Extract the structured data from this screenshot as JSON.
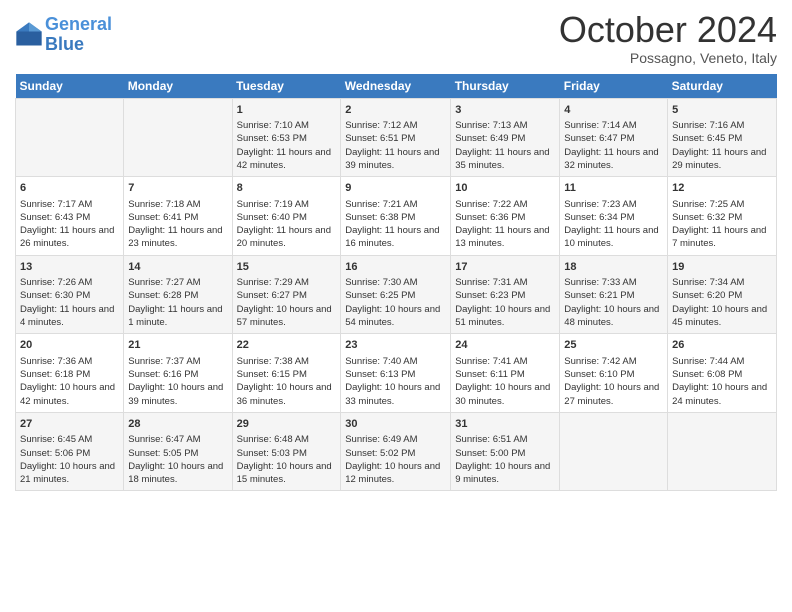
{
  "header": {
    "logo_line1": "General",
    "logo_line2": "Blue",
    "month": "October 2024",
    "location": "Possagno, Veneto, Italy"
  },
  "weekdays": [
    "Sunday",
    "Monday",
    "Tuesday",
    "Wednesday",
    "Thursday",
    "Friday",
    "Saturday"
  ],
  "weeks": [
    [
      {
        "day": "",
        "data": ""
      },
      {
        "day": "",
        "data": ""
      },
      {
        "day": "1",
        "data": "Sunrise: 7:10 AM\nSunset: 6:53 PM\nDaylight: 11 hours and 42 minutes."
      },
      {
        "day": "2",
        "data": "Sunrise: 7:12 AM\nSunset: 6:51 PM\nDaylight: 11 hours and 39 minutes."
      },
      {
        "day": "3",
        "data": "Sunrise: 7:13 AM\nSunset: 6:49 PM\nDaylight: 11 hours and 35 minutes."
      },
      {
        "day": "4",
        "data": "Sunrise: 7:14 AM\nSunset: 6:47 PM\nDaylight: 11 hours and 32 minutes."
      },
      {
        "day": "5",
        "data": "Sunrise: 7:16 AM\nSunset: 6:45 PM\nDaylight: 11 hours and 29 minutes."
      }
    ],
    [
      {
        "day": "6",
        "data": "Sunrise: 7:17 AM\nSunset: 6:43 PM\nDaylight: 11 hours and 26 minutes."
      },
      {
        "day": "7",
        "data": "Sunrise: 7:18 AM\nSunset: 6:41 PM\nDaylight: 11 hours and 23 minutes."
      },
      {
        "day": "8",
        "data": "Sunrise: 7:19 AM\nSunset: 6:40 PM\nDaylight: 11 hours and 20 minutes."
      },
      {
        "day": "9",
        "data": "Sunrise: 7:21 AM\nSunset: 6:38 PM\nDaylight: 11 hours and 16 minutes."
      },
      {
        "day": "10",
        "data": "Sunrise: 7:22 AM\nSunset: 6:36 PM\nDaylight: 11 hours and 13 minutes."
      },
      {
        "day": "11",
        "data": "Sunrise: 7:23 AM\nSunset: 6:34 PM\nDaylight: 11 hours and 10 minutes."
      },
      {
        "day": "12",
        "data": "Sunrise: 7:25 AM\nSunset: 6:32 PM\nDaylight: 11 hours and 7 minutes."
      }
    ],
    [
      {
        "day": "13",
        "data": "Sunrise: 7:26 AM\nSunset: 6:30 PM\nDaylight: 11 hours and 4 minutes."
      },
      {
        "day": "14",
        "data": "Sunrise: 7:27 AM\nSunset: 6:28 PM\nDaylight: 11 hours and 1 minute."
      },
      {
        "day": "15",
        "data": "Sunrise: 7:29 AM\nSunset: 6:27 PM\nDaylight: 10 hours and 57 minutes."
      },
      {
        "day": "16",
        "data": "Sunrise: 7:30 AM\nSunset: 6:25 PM\nDaylight: 10 hours and 54 minutes."
      },
      {
        "day": "17",
        "data": "Sunrise: 7:31 AM\nSunset: 6:23 PM\nDaylight: 10 hours and 51 minutes."
      },
      {
        "day": "18",
        "data": "Sunrise: 7:33 AM\nSunset: 6:21 PM\nDaylight: 10 hours and 48 minutes."
      },
      {
        "day": "19",
        "data": "Sunrise: 7:34 AM\nSunset: 6:20 PM\nDaylight: 10 hours and 45 minutes."
      }
    ],
    [
      {
        "day": "20",
        "data": "Sunrise: 7:36 AM\nSunset: 6:18 PM\nDaylight: 10 hours and 42 minutes."
      },
      {
        "day": "21",
        "data": "Sunrise: 7:37 AM\nSunset: 6:16 PM\nDaylight: 10 hours and 39 minutes."
      },
      {
        "day": "22",
        "data": "Sunrise: 7:38 AM\nSunset: 6:15 PM\nDaylight: 10 hours and 36 minutes."
      },
      {
        "day": "23",
        "data": "Sunrise: 7:40 AM\nSunset: 6:13 PM\nDaylight: 10 hours and 33 minutes."
      },
      {
        "day": "24",
        "data": "Sunrise: 7:41 AM\nSunset: 6:11 PM\nDaylight: 10 hours and 30 minutes."
      },
      {
        "day": "25",
        "data": "Sunrise: 7:42 AM\nSunset: 6:10 PM\nDaylight: 10 hours and 27 minutes."
      },
      {
        "day": "26",
        "data": "Sunrise: 7:44 AM\nSunset: 6:08 PM\nDaylight: 10 hours and 24 minutes."
      }
    ],
    [
      {
        "day": "27",
        "data": "Sunrise: 6:45 AM\nSunset: 5:06 PM\nDaylight: 10 hours and 21 minutes."
      },
      {
        "day": "28",
        "data": "Sunrise: 6:47 AM\nSunset: 5:05 PM\nDaylight: 10 hours and 18 minutes."
      },
      {
        "day": "29",
        "data": "Sunrise: 6:48 AM\nSunset: 5:03 PM\nDaylight: 10 hours and 15 minutes."
      },
      {
        "day": "30",
        "data": "Sunrise: 6:49 AM\nSunset: 5:02 PM\nDaylight: 10 hours and 12 minutes."
      },
      {
        "day": "31",
        "data": "Sunrise: 6:51 AM\nSunset: 5:00 PM\nDaylight: 10 hours and 9 minutes."
      },
      {
        "day": "",
        "data": ""
      },
      {
        "day": "",
        "data": ""
      }
    ]
  ]
}
